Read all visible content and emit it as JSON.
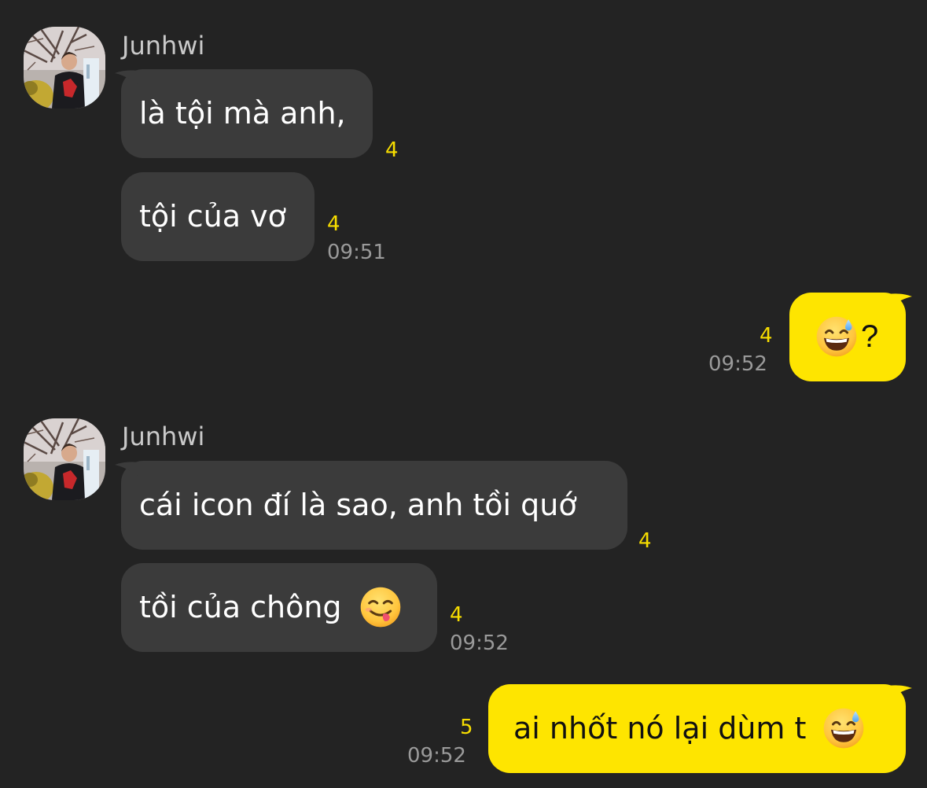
{
  "chat": {
    "groups": [
      {
        "sender": "Junhwi",
        "messages": [
          {
            "text": "là tội mà anh,",
            "unread": "4"
          },
          {
            "text": "tội của vơ",
            "unread": "4",
            "time": "09:51"
          }
        ]
      },
      {
        "mine": true,
        "messages": [
          {
            "text": "?",
            "emoji": "grinning-sweat-emoji",
            "unread": "4",
            "time": "09:52"
          }
        ]
      },
      {
        "sender": "Junhwi",
        "messages": [
          {
            "text": "cái icon đí là sao, anh tồi quớ",
            "unread": "4"
          },
          {
            "text": "tồi của chông",
            "emoji": "yum-face-emoji",
            "unread": "4",
            "time": "09:52"
          }
        ]
      },
      {
        "mine": true,
        "messages": [
          {
            "text": "ai nhốt nó lại dùm t",
            "emoji": "grinning-sweat-emoji",
            "unread": "5",
            "time": "09:52"
          }
        ]
      }
    ]
  },
  "colors": {
    "background": "#232323",
    "incoming_bubble": "#3b3b3b",
    "outgoing_bubble": "#fee500",
    "unread_count": "#f7dd00",
    "timestamp": "#9a9a9a",
    "sender_name": "#c9c9c9"
  }
}
